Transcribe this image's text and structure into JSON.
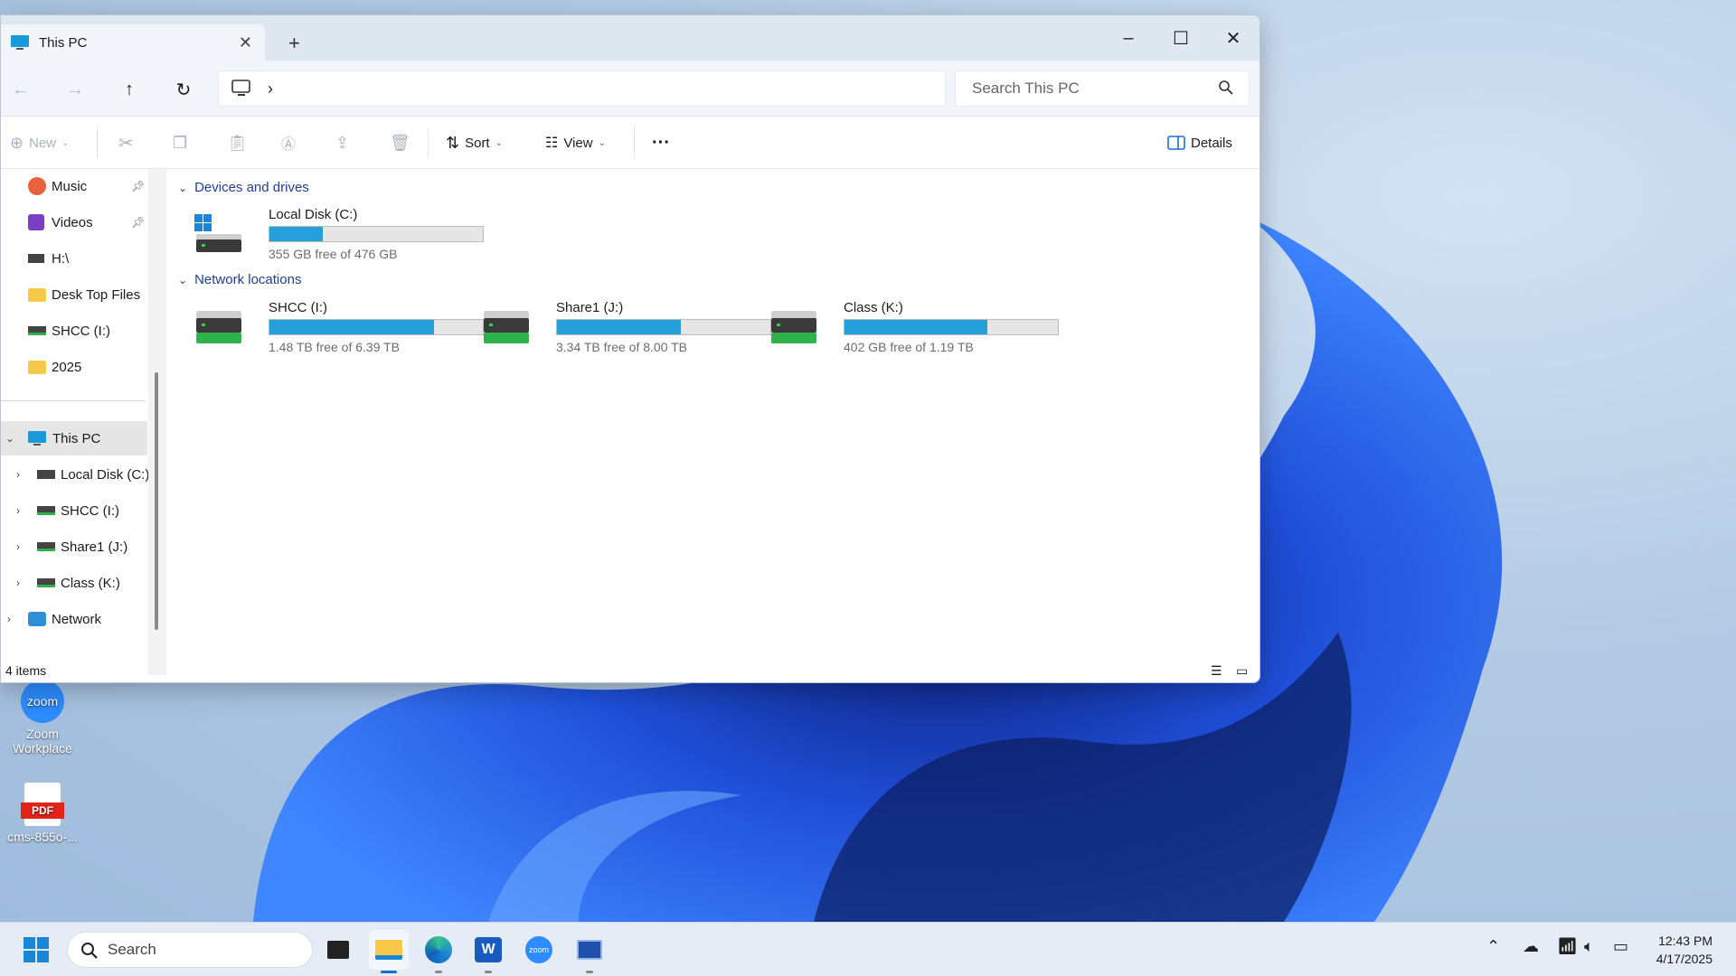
{
  "desktop": {
    "icons": [
      {
        "label_line1": "Zoom",
        "label_line2": "Workplace",
        "badge": "zoom"
      },
      {
        "label": "cms-855o-...",
        "badge": "PDF"
      }
    ]
  },
  "window": {
    "tab_title": "This PC",
    "search_placeholder": "Search This PC",
    "address_separator": "›",
    "toolbar": {
      "new_label": "New",
      "sort_label": "Sort",
      "view_label": "View",
      "more_label": "···",
      "details_label": "Details"
    },
    "nav": {
      "quick": [
        {
          "label": "Music",
          "icon": "music-icon",
          "pinned": true
        },
        {
          "label": "Videos",
          "icon": "videos-icon",
          "pinned": true
        },
        {
          "label": "H:\\",
          "icon": "drive-icon",
          "pinned": false
        },
        {
          "label": "Desk Top Files",
          "icon": "folder-icon",
          "pinned": false
        },
        {
          "label": "SHCC (I:)",
          "icon": "network-drive-icon",
          "pinned": false
        },
        {
          "label": "2025",
          "icon": "folder-icon",
          "pinned": false
        }
      ],
      "this_pc": "This PC",
      "drives": [
        "Local Disk (C:)",
        "SHCC (I:)",
        "Share1 (J:)",
        "Class (K:)"
      ],
      "network": "Network"
    },
    "content": {
      "devices_header": "Devices and drives",
      "network_header": "Network locations",
      "drives": [
        {
          "name": "Local Disk (C:)",
          "free_text": "355 GB free of 476 GB",
          "used_fraction": 0.25
        },
        {
          "name": "SHCC (I:)",
          "free_text": "1.48 TB free of 6.39 TB",
          "used_fraction": 0.77
        },
        {
          "name": "Share1 (J:)",
          "free_text": "3.34 TB free of 8.00 TB",
          "used_fraction": 0.58
        },
        {
          "name": "Class (K:)",
          "free_text": "402 GB free of 1.19 TB",
          "used_fraction": 0.67
        }
      ]
    },
    "status": "4 items"
  },
  "taskbar": {
    "search_label": "Search",
    "time": "12:43 PM",
    "date": "4/17/2025"
  },
  "colors": {
    "accent": "#26a0da",
    "header_blue": "#1f3f8c"
  }
}
